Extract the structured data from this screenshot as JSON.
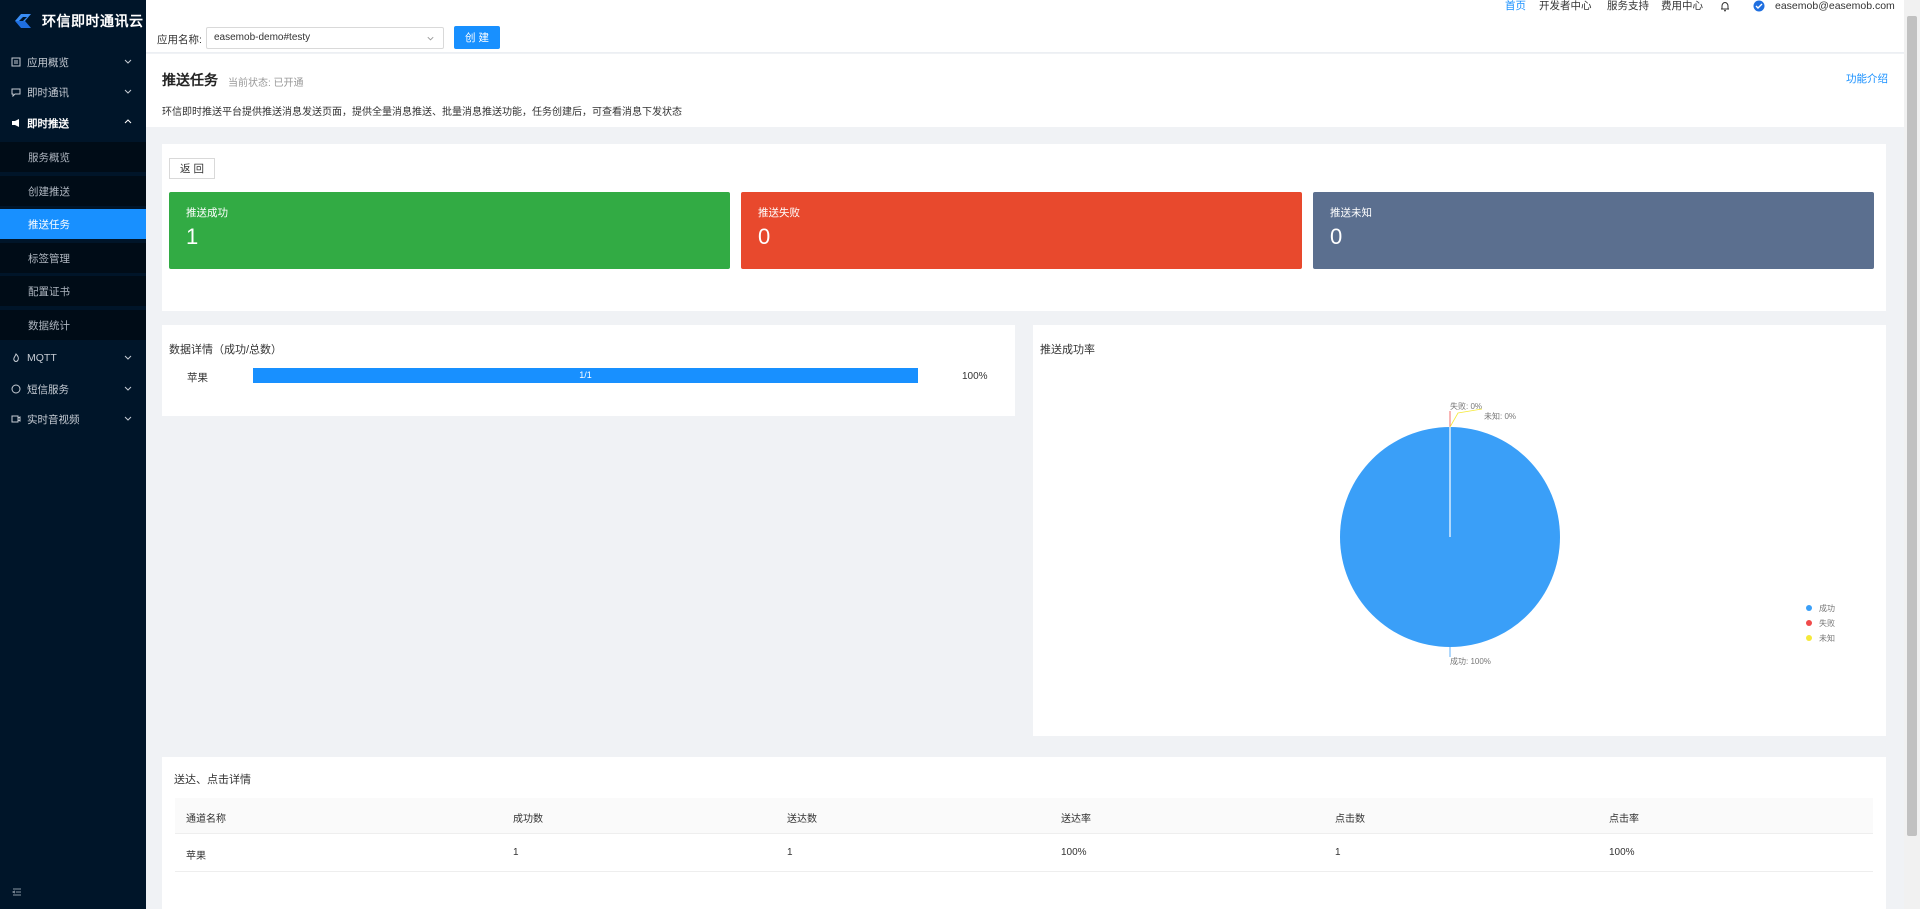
{
  "brand": {
    "name": "环信即时通讯云"
  },
  "sidebar": {
    "items": [
      {
        "label": "应用概览",
        "icon": "doc-icon"
      },
      {
        "label": "即时通讯",
        "icon": "chat-icon"
      },
      {
        "label": "即时推送",
        "icon": "push-icon",
        "open": true
      },
      {
        "label": "MQTT",
        "icon": "flame-icon"
      },
      {
        "label": "短信服务",
        "icon": "circle-icon"
      },
      {
        "label": "实时音视频",
        "icon": "video-icon"
      }
    ],
    "sub_items": [
      {
        "label": "服务概览"
      },
      {
        "label": "创建推送"
      },
      {
        "label": "推送任务",
        "active": true
      },
      {
        "label": "标签管理"
      },
      {
        "label": "配置证书"
      },
      {
        "label": "数据统计"
      }
    ]
  },
  "topnav": {
    "home": "首页",
    "developer": "开发者中心",
    "support": "服务支持",
    "billing": "费用中心",
    "user": "easemob@easemob.com"
  },
  "appbar": {
    "label": "应用名称:",
    "app_value": "easemob-demo#testy",
    "create_label": "创 建"
  },
  "header": {
    "title": "推送任务",
    "status": "当前状态: 已开通",
    "intro_link": "功能介绍",
    "description": "环信即时推送平台提供推送消息发送页面，提供全量消息推送、批量消息推送功能，任务创建后，可查看消息下发状态"
  },
  "stats": {
    "back_label": "返 回",
    "cards": [
      {
        "label": "推送成功",
        "value": "1",
        "color": "#32ab44"
      },
      {
        "label": "推送失败",
        "value": "0",
        "color": "#e8492d"
      },
      {
        "label": "推送未知",
        "value": "0",
        "color": "#5b6f8f"
      }
    ]
  },
  "detail": {
    "title": "数据详情（成功/总数）",
    "rows": [
      {
        "name": "苹果",
        "ratio_text": "1/1",
        "percent_text": "100%",
        "fraction": 1.0
      }
    ]
  },
  "pie": {
    "title": "推送成功率",
    "labels": {
      "success": "成功: 100%",
      "fail": "失败: 0%",
      "unknown": "未知: 0%"
    },
    "legend": [
      "成功",
      "失败",
      "未知"
    ]
  },
  "chart_data": {
    "type": "pie",
    "title": "推送成功率",
    "categories": [
      "成功",
      "失败",
      "未知"
    ],
    "values": [
      100,
      0,
      0
    ],
    "colors": [
      "#3a9ff8",
      "#f04a4a",
      "#f5e93a"
    ],
    "legend_position": "bottom-right"
  },
  "table": {
    "title": "送达、点击详情",
    "headers": [
      "通道名称",
      "成功数",
      "送达数",
      "送达率",
      "点击数",
      "点击率"
    ],
    "rows": [
      [
        "苹果",
        "1",
        "1",
        "100%",
        "1",
        "100%"
      ]
    ]
  },
  "colors": {
    "primary": "#1890ff",
    "sidebar_bg": "#001529"
  }
}
